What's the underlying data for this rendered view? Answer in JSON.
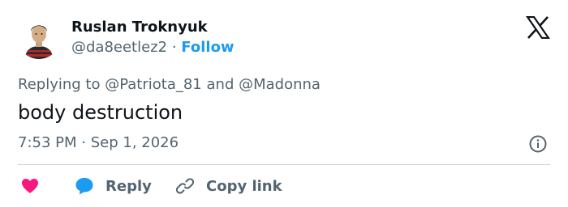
{
  "author": {
    "name": "Ruslan Troknyuk",
    "handle": "@da8eetlez2",
    "separator": "·",
    "follow_label": "Follow"
  },
  "reply_context": {
    "prefix": "Replying to",
    "mention_1": "@Patriota_81",
    "conjunction": "and",
    "mention_2": "@Madonna"
  },
  "tweet": {
    "text": "body destruction",
    "time": "7:53 PM",
    "separator": "·",
    "date": "Sep 1, 2026"
  },
  "actions": {
    "like_icon": "heart-icon",
    "reply_label": "Reply",
    "reply_icon": "speech-bubble-icon",
    "copy_label": "Copy link",
    "copy_icon": "link-icon"
  },
  "icons": {
    "brand": "x-logo-icon",
    "info": "info-icon"
  },
  "colors": {
    "accent": "#1d9bf0",
    "like": "#f91880",
    "text_primary": "#0f1419",
    "text_secondary": "#536471",
    "divider": "#cfd9de"
  }
}
